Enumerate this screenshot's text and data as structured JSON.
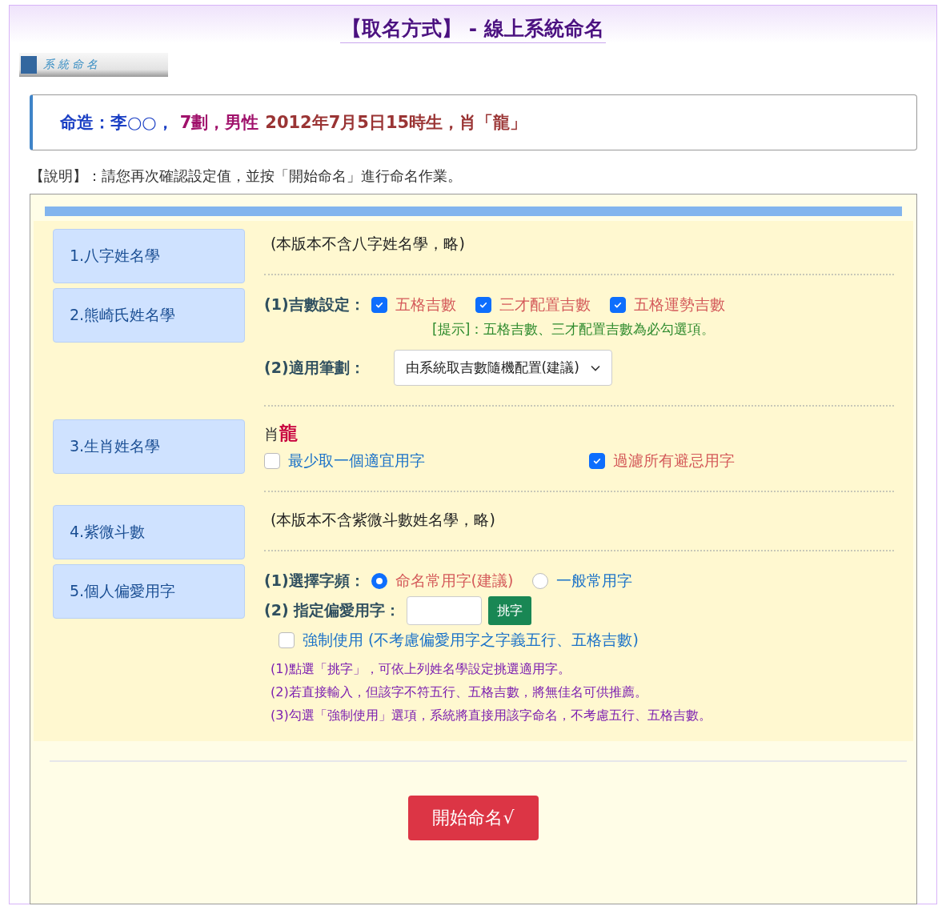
{
  "header": {
    "title": "【取名方式】 - 線上系統命名",
    "banner": "系統命名"
  },
  "info": [
    {
      "text": "命造：李○○，",
      "kind": "name"
    },
    {
      "text": "7劃，男性",
      "kind": "strokes"
    },
    {
      "text": "2012年7月5日15時生，肖「龍」",
      "kind": "birth"
    }
  ],
  "note": "【說明】：請您再次確認設定值，並按「開始命名」進行命名作業。",
  "sections": [
    {
      "label": "1.八字姓名學",
      "rows": [
        {
          "kind": "text",
          "text": "(本版本不含八字姓名學，略)"
        }
      ]
    },
    {
      "label": "2.熊崎氏姓名學",
      "rows": [
        {
          "kind": "checkboxes",
          "label": "(1)吉數設定：",
          "options": [
            {
              "label": "五格吉數",
              "checked": true
            },
            {
              "label": "三才配置吉數",
              "checked": true
            },
            {
              "label": "五格運勢吉數",
              "checked": true
            }
          ]
        },
        {
          "kind": "hint",
          "text": "[提示]：五格吉數、三才配置吉數為必勾選項。"
        },
        {
          "kind": "select",
          "label": "(2)適用筆劃：",
          "value": "由系統取吉數隨機配置(建議)"
        }
      ]
    },
    {
      "label": "3.生肖姓名學",
      "rows": [
        {
          "kind": "zodiac",
          "prefix": "肖",
          "value": "龍"
        },
        {
          "kind": "spread",
          "options": [
            {
              "label": "最少取一個適宜用字",
              "checked": false
            },
            {
              "label": "過濾所有避忌用字",
              "checked": true
            }
          ]
        }
      ]
    },
    {
      "label": "4.紫微斗數",
      "rows": [
        {
          "kind": "text",
          "text": "(本版本不含紫微斗數姓名學，略)"
        }
      ]
    },
    {
      "label": "5.個人偏愛用字",
      "rows": [
        {
          "kind": "radios",
          "label": "(1)選擇字頻：",
          "options": [
            {
              "label": "命名常用字(建議)",
              "selected": true
            },
            {
              "label": "一般常用字",
              "selected": false
            }
          ]
        },
        {
          "kind": "pick",
          "label": "(2) 指定偏愛用字：",
          "button": "挑字"
        },
        {
          "kind": "force",
          "label": "強制使用 (不考慮偏愛用字之字義五行、五格吉數)",
          "checked": false
        },
        {
          "kind": "notes",
          "items": [
            "(1)點選「挑字」，可依上列姓名學設定挑選適用字。",
            "(2)若直接輸入，但該字不符五行、五格吉數，將無佳名可供推薦。",
            "(3)勾選「強制使用」選項，系統將直接用該字命名，不考慮五行、五格吉數。"
          ]
        }
      ]
    }
  ],
  "submit": "開始命名√"
}
